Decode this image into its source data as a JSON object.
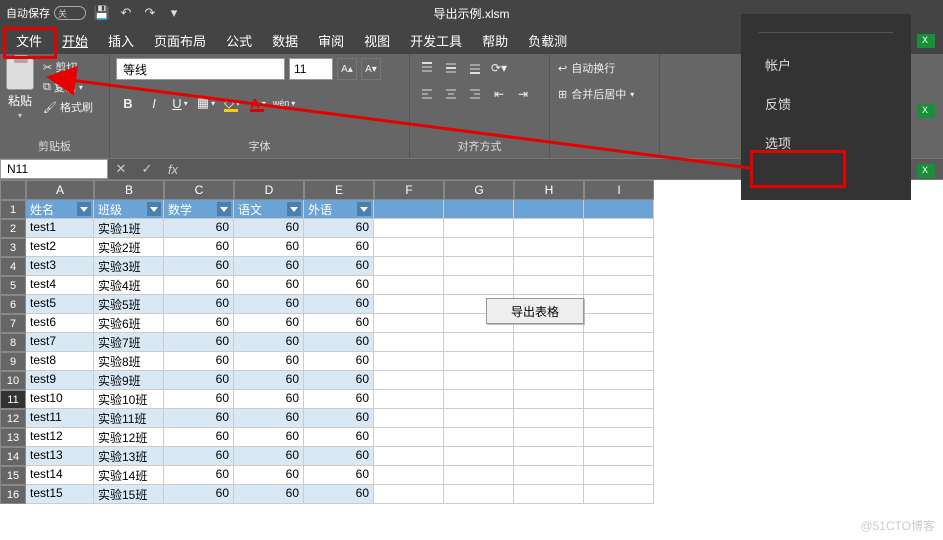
{
  "titlebar": {
    "autosave_label": "自动保存",
    "toggle_state": "关",
    "filename": "导出示例.xlsm"
  },
  "menu": {
    "file": "文件",
    "home": "开始",
    "insert": "插入",
    "layout": "页面布局",
    "formula": "公式",
    "data": "数据",
    "review": "审阅",
    "view": "视图",
    "dev": "开发工具",
    "help": "帮助",
    "load": "负载测"
  },
  "ribbon": {
    "clipboard": {
      "paste": "粘贴",
      "cut": "剪切",
      "copy": "复制",
      "format_painter": "格式刷",
      "group_label": "剪贴板"
    },
    "font": {
      "name": "等线",
      "size": "11",
      "group_label": "字体"
    },
    "align": {
      "group_label": "对齐方式"
    },
    "wrap": {
      "wrap_text": "自动换行",
      "merge_center": "合并后居中"
    }
  },
  "namebox": {
    "value": "N11"
  },
  "columns": [
    "A",
    "B",
    "C",
    "D",
    "E",
    "F",
    "G",
    "H",
    "I"
  ],
  "table": {
    "headers": [
      "姓名",
      "班级",
      "数学",
      "语文",
      "外语"
    ],
    "rows": [
      {
        "name": "test1",
        "class": "实验1班",
        "math": 60,
        "chinese": 60,
        "foreign": 60
      },
      {
        "name": "test2",
        "class": "实验2班",
        "math": 60,
        "chinese": 60,
        "foreign": 60
      },
      {
        "name": "test3",
        "class": "实验3班",
        "math": 60,
        "chinese": 60,
        "foreign": 60
      },
      {
        "name": "test4",
        "class": "实验4班",
        "math": 60,
        "chinese": 60,
        "foreign": 60
      },
      {
        "name": "test5",
        "class": "实验5班",
        "math": 60,
        "chinese": 60,
        "foreign": 60
      },
      {
        "name": "test6",
        "class": "实验6班",
        "math": 60,
        "chinese": 60,
        "foreign": 60
      },
      {
        "name": "test7",
        "class": "实验7班",
        "math": 60,
        "chinese": 60,
        "foreign": 60
      },
      {
        "name": "test8",
        "class": "实验8班",
        "math": 60,
        "chinese": 60,
        "foreign": 60
      },
      {
        "name": "test9",
        "class": "实验9班",
        "math": 60,
        "chinese": 60,
        "foreign": 60
      },
      {
        "name": "test10",
        "class": "实验10班",
        "math": 60,
        "chinese": 60,
        "foreign": 60
      },
      {
        "name": "test11",
        "class": "实验11班",
        "math": 60,
        "chinese": 60,
        "foreign": 60
      },
      {
        "name": "test12",
        "class": "实验12班",
        "math": 60,
        "chinese": 60,
        "foreign": 60
      },
      {
        "name": "test13",
        "class": "实验13班",
        "math": 60,
        "chinese": 60,
        "foreign": 60
      },
      {
        "name": "test14",
        "class": "实验14班",
        "math": 60,
        "chinese": 60,
        "foreign": 60
      },
      {
        "name": "test15",
        "class": "实验15班",
        "math": 60,
        "chinese": 60,
        "foreign": 60
      }
    ]
  },
  "export_button": "导出表格",
  "side_panel": {
    "account": "帐户",
    "feedback": "反馈",
    "options": "选项"
  },
  "watermark": "@51CTO博客"
}
